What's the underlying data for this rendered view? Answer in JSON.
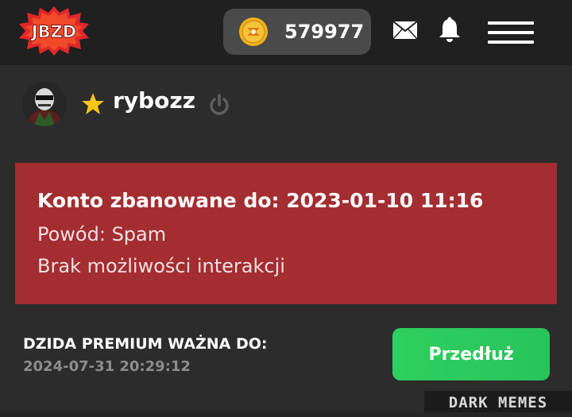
{
  "header": {
    "logo_text": "JBZD",
    "coins": "579977",
    "icons": [
      "coin-icon",
      "mail-icon",
      "bell-icon",
      "menu-icon"
    ]
  },
  "user": {
    "username": "rybozz",
    "icons": [
      "avatar",
      "star-icon",
      "power-icon"
    ]
  },
  "ban": {
    "title": "Konto zbanowane do: 2023-01-10 11:16",
    "reason": "Powód: Spam",
    "interaction": "Brak możliwości interakcji"
  },
  "premium": {
    "label": "DZIDA PREMIUM WAŻNA DO:",
    "date": "2024-07-31 20:29:12",
    "extend_label": "Przedłuż"
  },
  "watermark": "DARK MEMES",
  "colors": {
    "background": "#2c2c2c",
    "topbar": "#202020",
    "ban_box": "#a32d31",
    "extend_button": "#2fcf5f",
    "coin": "#f2b21d",
    "star": "#f5c518"
  }
}
